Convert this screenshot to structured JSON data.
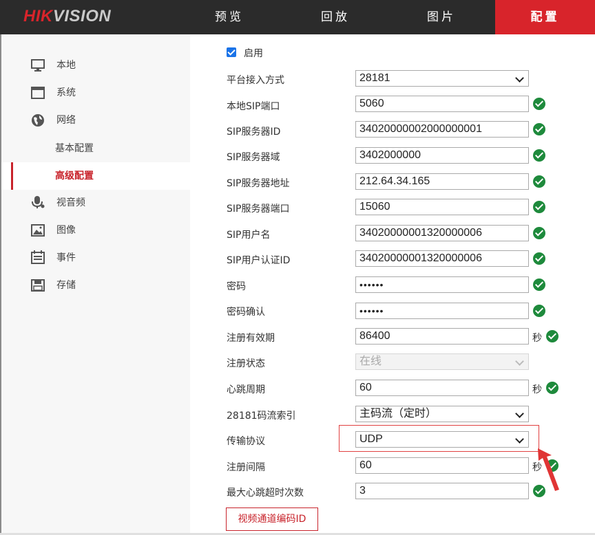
{
  "brand": {
    "logo_red": "HIK",
    "logo_grey": "VISION"
  },
  "nav": [
    {
      "label": "预览"
    },
    {
      "label": "回放"
    },
    {
      "label": "图片"
    },
    {
      "label": "配置",
      "active": true
    }
  ],
  "sidebar": {
    "items": [
      {
        "label": "本地",
        "icon": "monitor-icon"
      },
      {
        "label": "系统",
        "icon": "system-icon"
      },
      {
        "label": "网络",
        "icon": "globe-icon"
      },
      {
        "label": "基本配置"
      },
      {
        "label": "高级配置",
        "active": true
      },
      {
        "label": "视音频",
        "icon": "microphone-icon"
      },
      {
        "label": "图像",
        "icon": "image-icon"
      },
      {
        "label": "事件",
        "icon": "calendar-icon"
      },
      {
        "label": "存储",
        "icon": "floppy-icon"
      }
    ]
  },
  "form": {
    "enable_label": "启用",
    "enabled": true,
    "unit_seconds": "秒",
    "fields": [
      {
        "label": "平台接入方式",
        "value": "28181",
        "type": "select"
      },
      {
        "label": "本地SIP端口",
        "value": "5060"
      },
      {
        "label": "SIP服务器ID",
        "value": "34020000002000000001"
      },
      {
        "label": "SIP服务器域",
        "value": "3402000000"
      },
      {
        "label": "SIP服务器地址",
        "value": "212.64.34.165"
      },
      {
        "label": "SIP服务器端口",
        "value": "15060"
      },
      {
        "label": "SIP用户名",
        "value": "34020000001320000006"
      },
      {
        "label": "SIP用户认证ID",
        "value": "34020000001320000006"
      },
      {
        "label": "密码",
        "value": "••••••"
      },
      {
        "label": "密码确认",
        "value": "••••••"
      },
      {
        "label": "注册有效期",
        "value": "86400"
      },
      {
        "label": "注册状态",
        "value": "在线",
        "type": "select",
        "disabled": true
      },
      {
        "label": "心跳周期",
        "value": "60"
      },
      {
        "label": "28181码流索引",
        "value": "主码流（定时）",
        "type": "select"
      },
      {
        "label": "传输协议",
        "value": "UDP",
        "type": "select"
      },
      {
        "label": "注册间隔",
        "value": "60"
      },
      {
        "label": "最大心跳超时次数",
        "value": "3"
      }
    ],
    "channel_button": "视频通道编码ID"
  },
  "colors": {
    "accent": "#d8242b",
    "ok": "#1e8a3c",
    "topbar": "#2b2b2b",
    "annotation": "#e04040"
  }
}
